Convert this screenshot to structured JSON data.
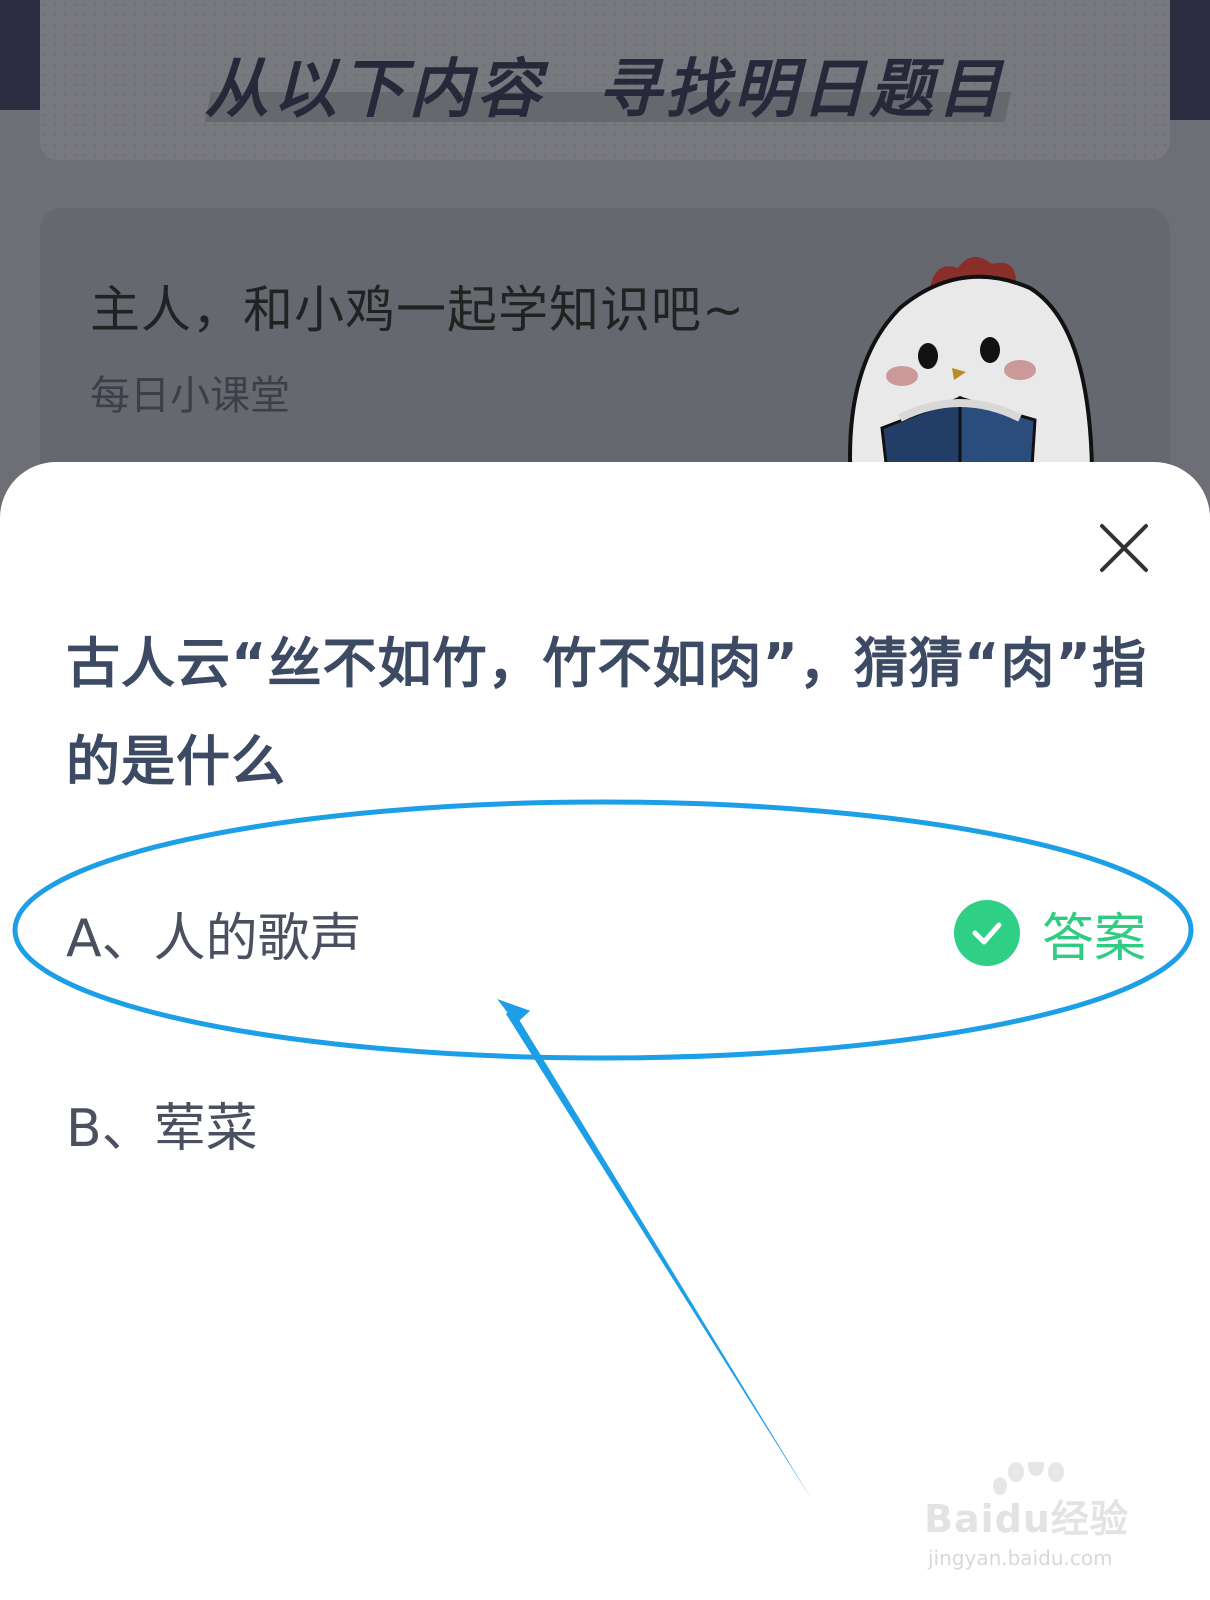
{
  "background": {
    "banner_title": "从以下内容  寻找明日题目",
    "card": {
      "title": "主人，和小鸡一起学知识吧~",
      "subtitle": "每日小课堂"
    }
  },
  "sheet": {
    "question": "古人云“丝不如竹，竹不如肉”，猜猜“肉”指的是什么",
    "options": [
      {
        "text": "A、人的歌声",
        "is_answer": true
      },
      {
        "text": "B、荤菜",
        "is_answer": false
      }
    ],
    "answer_label": "答案",
    "close_icon": "close-icon",
    "check_icon": "check-circle-icon"
  },
  "colors": {
    "question_text": "#3d4a63",
    "answer_green": "#2fd086",
    "annotation_blue": "#1d9fe8"
  },
  "watermark": {
    "text": "Baidu经验",
    "url": "jingyan.baidu.com"
  }
}
